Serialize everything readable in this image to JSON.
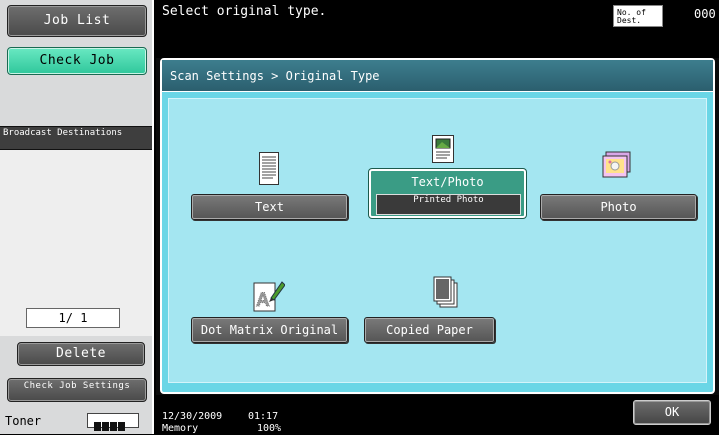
{
  "sidebar": {
    "job_list": "Job List",
    "check_job": "Check Job",
    "broadcast": "Broadcast Destinations",
    "page_counter": "1/ 1",
    "delete": "Delete",
    "check_job_settings": "Check Job Settings",
    "toner": "Toner"
  },
  "header": {
    "message": "Select original type.",
    "dest_label": "No. of Dest.",
    "dest_count": "000"
  },
  "panel": {
    "breadcrumb": "Scan Settings > Original Type",
    "options": [
      {
        "label": "Text",
        "icon": "text-document-icon",
        "selected": false
      },
      {
        "label": "Text/Photo",
        "sub_label": "Printed Photo",
        "icon": "text-photo-document-icon",
        "selected": true
      },
      {
        "label": "Photo",
        "icon": "photo-icon",
        "selected": false
      },
      {
        "label": "Dot Matrix Original",
        "icon": "dot-matrix-icon",
        "selected": false
      },
      {
        "label": "Copied Paper",
        "icon": "copied-paper-icon",
        "selected": false
      }
    ]
  },
  "footer": {
    "date": "12/30/2009",
    "time": "01:17",
    "memory_label": "Memory",
    "memory_value": "100%",
    "ok": "OK"
  },
  "colors": {
    "panel_bg": "#a4e6f1",
    "accent_green": "#2fc79b",
    "selected": "#3a9c85"
  }
}
